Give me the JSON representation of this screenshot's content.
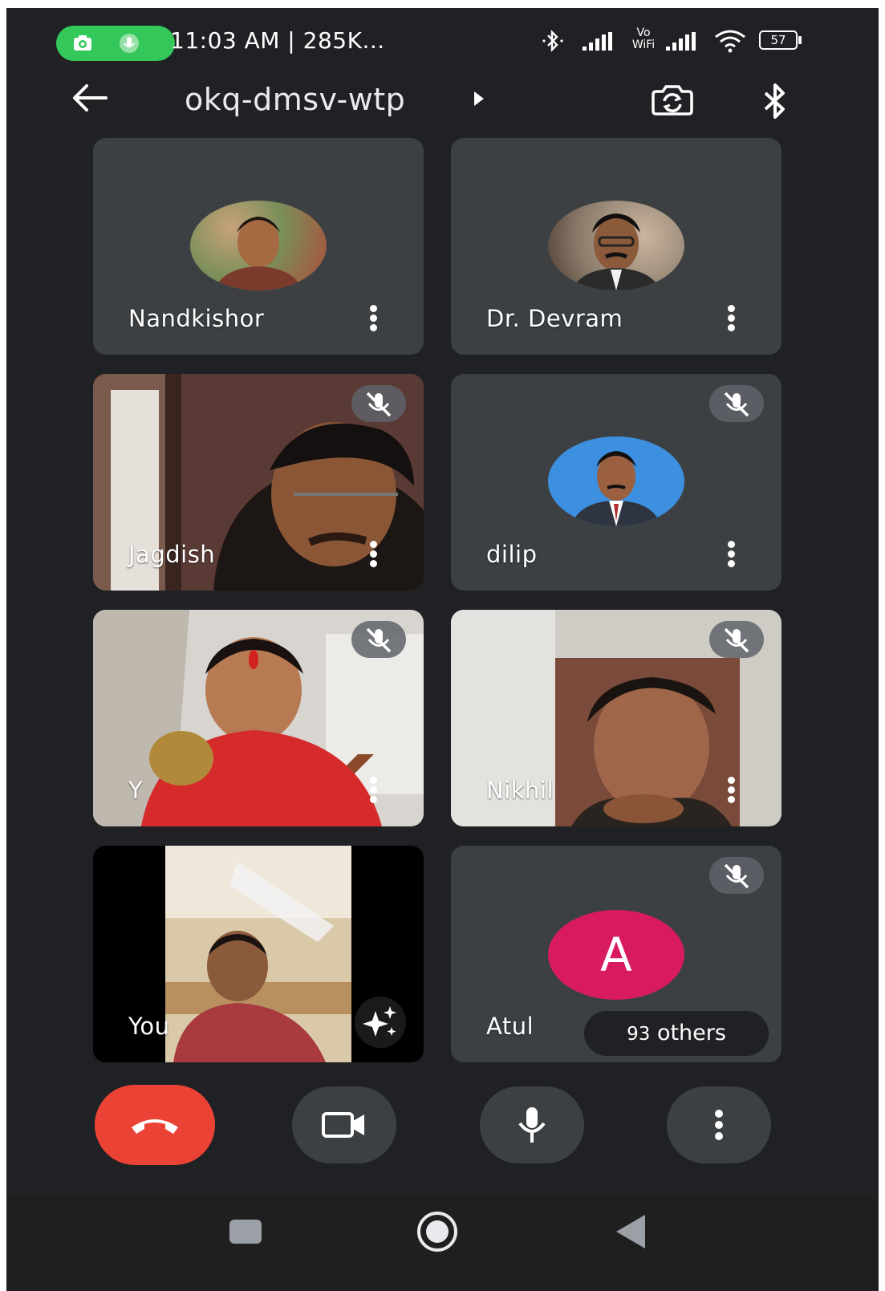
{
  "status_bar": {
    "time_text": "11:03 AM | 285K...",
    "wifi_badge_line1": "Vo",
    "wifi_badge_line2": "WiFi",
    "battery": "57"
  },
  "top_bar": {
    "meeting_code": "okq-dmsv-wtp"
  },
  "participants": [
    {
      "name": "Nandkishor",
      "muted": false,
      "view": "avatar"
    },
    {
      "name": "Dr. Devram",
      "muted": false,
      "view": "avatar"
    },
    {
      "name": "Jagdish",
      "muted": true,
      "view": "video"
    },
    {
      "name": "dilip",
      "muted": true,
      "view": "avatar"
    },
    {
      "name": "Y",
      "muted": true,
      "view": "video"
    },
    {
      "name": "Nikhil",
      "muted": true,
      "view": "video"
    },
    {
      "name": "You",
      "muted": false,
      "view": "video"
    },
    {
      "name": "Atul",
      "muted": true,
      "view": "initial",
      "initial": "A",
      "initial_color": "#d81b60"
    }
  ],
  "others_pill": {
    "count": "93",
    "label": "others"
  },
  "controls": {
    "end_call_color": "#ea4335",
    "buttons": [
      "end-call",
      "camera",
      "microphone",
      "more-options"
    ]
  },
  "theme": {
    "background": "#202124",
    "tile": "#3c4043",
    "status_pill": "#34c759"
  }
}
